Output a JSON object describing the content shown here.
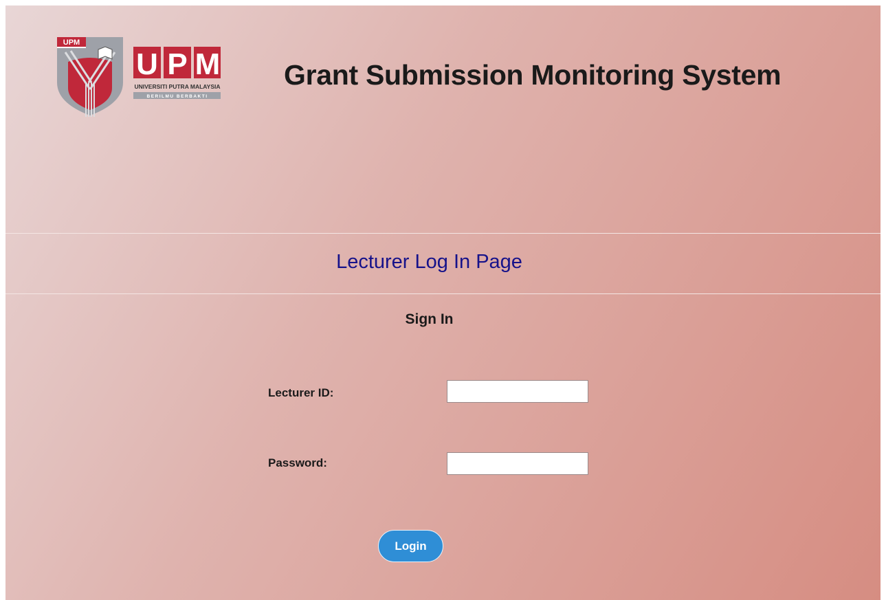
{
  "header": {
    "site_title": "Grant Submission Monitoring System",
    "logo": {
      "icon": "upm-logo-icon",
      "badge_text": "UPM",
      "wordmark": "UPM",
      "university_name": "UNIVERSITI PUTRA MALAYSIA",
      "motto": "BERILMU BERBAKTI",
      "colors": {
        "shield_red": "#c0283a",
        "shield_grey": "#9ea1a8",
        "wordmark_red": "#c0283a"
      }
    }
  },
  "page": {
    "heading": "Lecturer Log In Page",
    "heading_color": "#16128a"
  },
  "form": {
    "title": "Sign In",
    "fields": [
      {
        "label": "Lecturer ID:",
        "value": "",
        "placeholder": ""
      },
      {
        "label": "Password:",
        "value": "",
        "placeholder": ""
      }
    ],
    "login_label": "Login",
    "login_color": "#2f8ed6"
  }
}
